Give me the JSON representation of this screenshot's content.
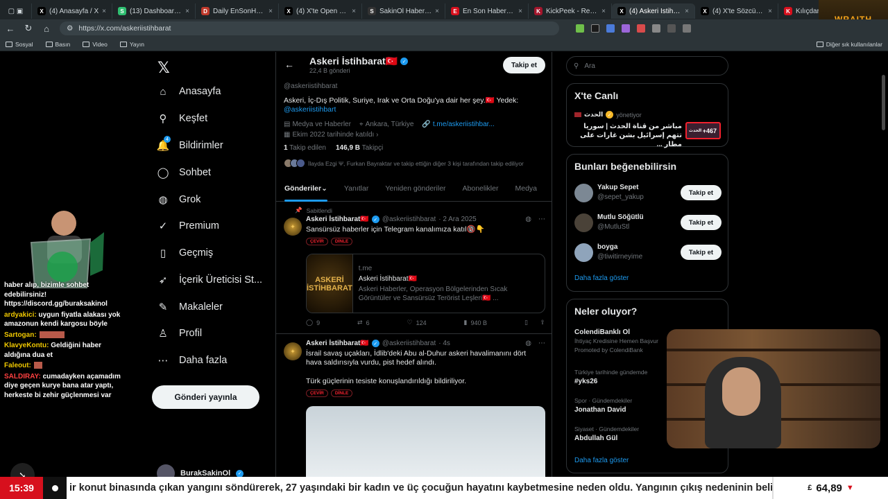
{
  "browser": {
    "tabs": [
      {
        "title": "(4) Anasayfa / X",
        "fav": "X",
        "color": "#000"
      },
      {
        "title": "(13) Dashboard / St",
        "fav": "S",
        "color": "#2fbf71"
      },
      {
        "title": "Daily EnSonHaber",
        "fav": "D",
        "color": "#c0392b"
      },
      {
        "title": "(4) X'te Open Sourc",
        "fav": "X",
        "color": "#000"
      },
      {
        "title": "SakinOl Haber Mer",
        "fav": "S",
        "color": "#333"
      },
      {
        "title": "En Son Haber - Hab",
        "fav": "E",
        "color": "#d7101d"
      },
      {
        "title": "KickPeek - Real-tim",
        "fav": "K",
        "color": "#a3162c"
      },
      {
        "title": "(4) Askeri İstihbara",
        "fav": "X",
        "color": "#000",
        "active": true
      },
      {
        "title": "(4) X'te Sözcü: \"CHP",
        "fav": "X",
        "color": "#000"
      },
      {
        "title": "Kılıçdaroğlu geri adı",
        "fav": "K",
        "color": "#d7101d"
      }
    ],
    "url": "https://x.com/askeriistihbarat",
    "bookmarks": [
      "Sosyal",
      "Basın",
      "Video",
      "Yayın"
    ],
    "bookmarks_right": "Diğer sık kullanılanlar",
    "wraith_label": "WRAITH"
  },
  "nav": {
    "items": [
      {
        "label": "Anasayfa",
        "icon": "home-icon",
        "glyph": "⌂"
      },
      {
        "label": "Keşfet",
        "icon": "search-icon",
        "glyph": "⚲"
      },
      {
        "label": "Bildirimler",
        "icon": "bell-icon",
        "glyph": "🔔"
      },
      {
        "label": "Sohbet",
        "icon": "chat-icon",
        "glyph": "◯"
      },
      {
        "label": "Grok",
        "icon": "grok-icon",
        "glyph": "◍"
      },
      {
        "label": "Premium",
        "icon": "premium-icon",
        "glyph": "✓"
      },
      {
        "label": "Geçmiş",
        "icon": "bookmark-icon",
        "glyph": "▯"
      },
      {
        "label": "İçerik Üreticisi St...",
        "icon": "rocket-icon",
        "glyph": "➶"
      },
      {
        "label": "Makaleler",
        "icon": "article-icon",
        "glyph": "✎"
      },
      {
        "label": "Profil",
        "icon": "profile-icon",
        "glyph": "♙"
      },
      {
        "label": "Daha fazla",
        "icon": "more-icon",
        "glyph": "⋯"
      }
    ],
    "notif_badge": "4",
    "post_button": "Gönderi yayınla",
    "me_name": "BurakSakinOl"
  },
  "profile": {
    "name": "Askeri İstihbarat🇹🇷",
    "posts_count": "22,4 B gönderi",
    "follow_label": "Takip et",
    "handle": "@askeriistihbarat",
    "bio": "Askeri, İç-Dış Politik, Suriye, Irak ve Orta Doğu'ya dair her şey.🇹🇷 Yedek:",
    "bio_link": "@askeriistihbart",
    "category": "Medya ve Haberler",
    "location": "Ankara, Türkiye",
    "website": "t.me/askeriistihbar...",
    "joined": "Ekim 2022 tarihinde katıldı",
    "following_count": "1",
    "following_label": "Takip edilen",
    "followers_count": "146,9 B",
    "followers_label": "Takipçi",
    "followed_by": "İlayda Ezgi Ψ, Furkan Bayraktar ve takip ettiğin diğer 3 kişi tarafından takip ediliyor",
    "tabs": [
      "Gönderiler",
      "Yanıtlar",
      "Yeniden gönderiler",
      "Abonelikler",
      "Medya"
    ]
  },
  "tweets": [
    {
      "pinned_label": "Sabitlendi",
      "name": "Askeri İstihbarat🇹🇷",
      "handle": "@askeriistihbarat",
      "time": "· 2 Ara 2025",
      "text": "Sansürsüz haberler için Telegram kanalımıza katıl🔞👇",
      "pill1": "ÇEVİR",
      "pill2": "DİNLE",
      "card_img": "ASKERİ İSTİHBARAT",
      "card_domain": "t.me",
      "card_title": "Askeri İstihbarat🇹🇷",
      "card_desc": "Askeri Haberler, Operasyon Bölgelerinden Sıcak Görüntüler ve Sansürsüz Terörist Leşleri🇹🇷 ...",
      "replies": "9",
      "reposts": "6",
      "likes": "124",
      "views": "940 B"
    },
    {
      "name": "Askeri İstihbarat🇹🇷",
      "handle": "@askeriistihbarat",
      "time": "· 4s",
      "text": "İsrail savaş uçakları, İdlib'deki Abu al-Duhur askeri havalimanını dört hava saldırısıyla vurdu, pist hedef alındı.",
      "text2": "Türk güçlerinin tesiste konuşlandırıldığı bildiriliyor.",
      "pill1": "ÇEVİR",
      "pill2": "DİNLE"
    }
  ],
  "right": {
    "search_placeholder": "Ara",
    "live_title": "X'te Canlı",
    "live_source": "الحدث",
    "live_role": "yönetiyor",
    "live_text": "مباشر من قناة الحدث | سوريا تتهم إسرائيل بشن غارات على مطار ...",
    "live_count": "+467",
    "live_thumb": "الحدث",
    "wtf_title": "Bunları beğenebilirsin",
    "wtf": [
      {
        "name": "Yakup Sepet",
        "handle": "@sepet_yakup"
      },
      {
        "name": "Mutlu Söğütlü",
        "handle": "@MutluStl"
      },
      {
        "name": "boyga",
        "handle": "@tiwitirneyime"
      }
    ],
    "wtf_follow": "Takip et",
    "show_more": "Daha fazla göster",
    "trends_title": "Neler oluyor?",
    "trends": [
      {
        "context": "",
        "name": "ColendiBanklı Ol",
        "sub": "İhtiyaç Kredisine Hemen Başvur",
        "promo": "Promoted by ColendiBank"
      },
      {
        "context": "Türkiye tarihinde gündemde",
        "name": "#yks26"
      },
      {
        "context": "Spor · Gündemdekiler",
        "name": "Jonathan David"
      },
      {
        "context": "Siyaset · Gündemdekiler",
        "name": "Abdullah Gül"
      }
    ]
  },
  "chat": [
    {
      "user": "",
      "text": "haber alıp, bizimle sohbet edebilirsiniz! https://discord.gg/buraksakinol"
    },
    {
      "user": "ardyakici:",
      "text": " uygun fiyatla alakası yok amazonun kendi kargosu böyle"
    },
    {
      "user": "Sartogan:",
      "text": ""
    },
    {
      "user": "KlavyeKontu:",
      "text": " Geldiğini haber aldığına dua et"
    },
    {
      "user": "Faleout:",
      "text": ""
    },
    {
      "user": "SALDIRAY:",
      "text": " cumadayken açamadım diye geçen kurye bana atar yaptı, herkeste bi zehir güçlenmesi var"
    }
  ],
  "ticker": {
    "time": "15:39",
    "text": "ir konut binasında çıkan yangını söndürerek, 27 yaşındaki bir kadın ve üç çocuğun hayatını kaybetmesine neden oldu. Yangının çıkış nedeninin belirlenmesi v",
    "currency": "£",
    "price": "64,89",
    "direction": "▼"
  }
}
